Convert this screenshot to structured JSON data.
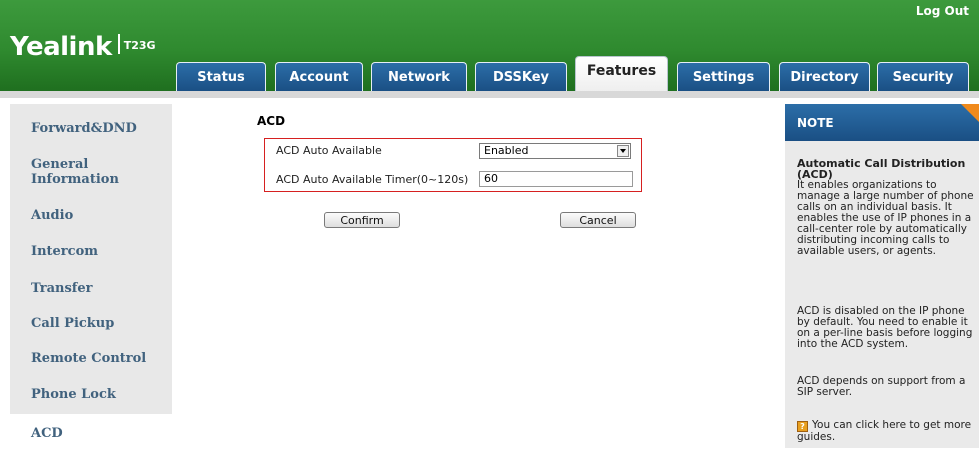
{
  "header": {
    "logout_label": "Log Out",
    "logo_text": "Yealink",
    "model_text": "T23G",
    "tabs": [
      {
        "label": "Status"
      },
      {
        "label": "Account"
      },
      {
        "label": "Network"
      },
      {
        "label": "DSSKey"
      },
      {
        "label": "Features",
        "active": true
      },
      {
        "label": "Settings"
      },
      {
        "label": "Directory"
      },
      {
        "label": "Security"
      }
    ],
    "colors": {
      "header_green": "#2f8a2f",
      "tab_blue": "#1a4f84",
      "note_accent": "#f08a1c",
      "highlight_red": "#d62020"
    }
  },
  "sidebar": {
    "items": [
      {
        "label": "Forward&DND"
      },
      {
        "label": "General Information"
      },
      {
        "label": "Audio"
      },
      {
        "label": "Intercom"
      },
      {
        "label": "Transfer"
      },
      {
        "label": "Call Pickup"
      },
      {
        "label": "Remote Control"
      },
      {
        "label": "Phone Lock"
      },
      {
        "label": "ACD",
        "active": true
      }
    ]
  },
  "main": {
    "section_title": "ACD",
    "fields": {
      "auto_available_label": "ACD Auto Available",
      "auto_available_value": "Enabled",
      "timer_label": "ACD Auto Available Timer(0~120s)",
      "timer_value": "60"
    },
    "buttons": {
      "confirm": "Confirm",
      "cancel": "Cancel"
    }
  },
  "note": {
    "title": "NOTE",
    "subtitle": "Automatic Call Distribution (ACD)",
    "para1": "It enables organizations to manage a large number of phone calls on an individual basis. It enables the use of IP phones in a call-center role by automatically distributing incoming calls to available users, or agents.",
    "para2": "ACD is disabled on the IP phone by default. You need to enable it on a per-line basis before logging into the ACD system.",
    "para3": "ACD depends on support from a SIP server.",
    "guide": "You can click here to get more guides.",
    "guide_icon": "help-book-icon"
  }
}
